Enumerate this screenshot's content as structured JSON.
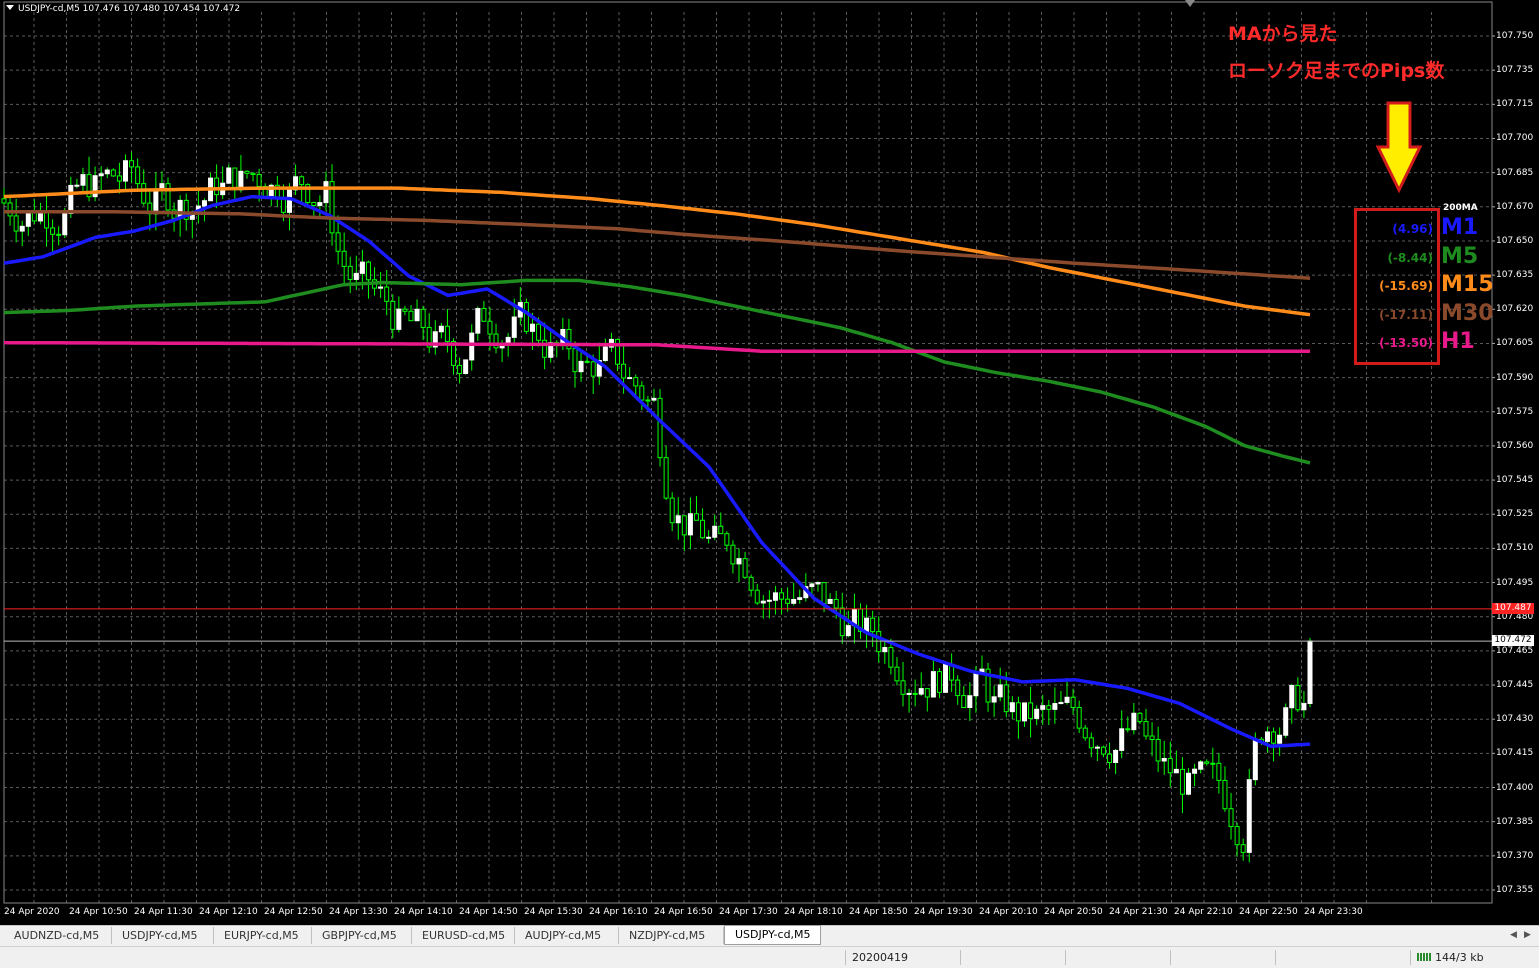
{
  "chart_header": {
    "text": "USDJPY-cd,M5  107.476 107.480 107.454 107.472"
  },
  "y_axis": {
    "labels": [
      "107.750",
      "107.735",
      "107.715",
      "107.700",
      "107.685",
      "107.670",
      "107.650",
      "107.635",
      "107.620",
      "107.605",
      "107.590",
      "107.575",
      "107.560",
      "107.545",
      "107.525",
      "107.510",
      "107.495",
      "107.480",
      "107.465",
      "107.445",
      "107.430",
      "107.415",
      "107.400",
      "107.385",
      "107.370",
      "107.355"
    ],
    "price_tags": [
      {
        "text": "107.487",
        "color": "#ff2222",
        "text_color": "#ffffff"
      },
      {
        "text": "107.472",
        "color": "#ffffff",
        "text_color": "#000000"
      }
    ]
  },
  "x_axis": {
    "labels": [
      "24 Apr 2020",
      "24 Apr 10:50",
      "24 Apr 11:30",
      "24 Apr 12:10",
      "24 Apr 12:50",
      "24 Apr 13:30",
      "24 Apr 14:10",
      "24 Apr 14:50",
      "24 Apr 15:30",
      "24 Apr 16:10",
      "24 Apr 16:50",
      "24 Apr 17:30",
      "24 Apr 18:10",
      "24 Apr 18:50",
      "24 Apr 19:30",
      "24 Apr 20:10",
      "24 Apr 20:50",
      "24 Apr 21:30",
      "24 Apr 22:10",
      "24 Apr 22:50",
      "24 Apr 23:30"
    ]
  },
  "annotation": {
    "line1": "MAから見た",
    "line2": "ローソク足までのPips数",
    "arrow_color": "#ffee00",
    "box_color": "#d21c1c"
  },
  "ma_panel": {
    "title": "200MA",
    "rows": [
      {
        "value": "(4.96)",
        "tf": "M1",
        "color": "#1a1aff"
      },
      {
        "value": "(-8.44)",
        "tf": "M5",
        "color": "#1e8c1e"
      },
      {
        "value": "(-15.69)",
        "tf": "M15",
        "color": "#ff8c1a"
      },
      {
        "value": "(-17.11)",
        "tf": "M30",
        "color": "#8b4a2b"
      },
      {
        "value": "(-13.50)",
        "tf": "H1",
        "color": "#e8198b"
      }
    ]
  },
  "colors": {
    "background": "#000000",
    "grid": "#5a5a5a",
    "bull": "#ffffff",
    "bear": "#00ff00",
    "candle_outline": "#00ff00"
  },
  "tabs": [
    "AUDNZD-cd,M5",
    "USDJPY-cd,M5",
    "EURJPY-cd,M5",
    "GBPJPY-cd,M5",
    "EURUSD-cd,M5",
    "AUDJPY-cd,M5",
    "NZDJPY-cd,M5",
    "USDJPY-cd,M5"
  ],
  "active_tab_index": 7,
  "status_bar": {
    "profile": "20200419",
    "traffic": "144/3 kb"
  },
  "chart_data": {
    "type": "candlestick",
    "symbol": "USDJPY-cd",
    "timeframe": "M5",
    "ylim": [
      107.35,
      107.765
    ],
    "last": {
      "open": 107.476,
      "high": 107.48,
      "low": 107.454,
      "close": 107.472
    },
    "bid_line": 107.487,
    "moving_averages": [
      {
        "name": "M1",
        "color": "#1a1aff",
        "pips": "(4.96)",
        "points": [
          [
            0,
            107.648
          ],
          [
            0.03,
            107.651
          ],
          [
            0.07,
            107.66
          ],
          [
            0.1,
            107.663
          ],
          [
            0.13,
            107.668
          ],
          [
            0.16,
            107.675
          ],
          [
            0.19,
            107.679
          ],
          [
            0.22,
            107.678
          ],
          [
            0.25,
            107.67
          ],
          [
            0.28,
            107.658
          ],
          [
            0.31,
            107.642
          ],
          [
            0.34,
            107.633
          ],
          [
            0.37,
            107.636
          ],
          [
            0.4,
            107.625
          ],
          [
            0.43,
            107.612
          ],
          [
            0.46,
            107.6
          ],
          [
            0.5,
            107.576
          ],
          [
            0.54,
            107.553
          ],
          [
            0.58,
            107.518
          ],
          [
            0.62,
            107.492
          ],
          [
            0.66,
            107.476
          ],
          [
            0.7,
            107.466
          ],
          [
            0.74,
            107.458
          ],
          [
            0.78,
            107.453
          ],
          [
            0.82,
            107.454
          ],
          [
            0.86,
            107.45
          ],
          [
            0.9,
            107.443
          ],
          [
            0.94,
            107.431
          ],
          [
            0.97,
            107.423
          ],
          [
            1,
            107.424
          ]
        ]
      },
      {
        "name": "M5",
        "color": "#1e8c1e",
        "points": [
          [
            0,
            107.625
          ],
          [
            0.05,
            107.626
          ],
          [
            0.1,
            107.628
          ],
          [
            0.15,
            107.629
          ],
          [
            0.2,
            107.63
          ],
          [
            0.23,
            107.634
          ],
          [
            0.26,
            107.638
          ],
          [
            0.29,
            107.639
          ],
          [
            0.35,
            107.638
          ],
          [
            0.4,
            107.64
          ],
          [
            0.44,
            107.64
          ],
          [
            0.48,
            107.637
          ],
          [
            0.52,
            107.633
          ],
          [
            0.56,
            107.628
          ],
          [
            0.6,
            107.623
          ],
          [
            0.64,
            107.618
          ],
          [
            0.68,
            107.611
          ],
          [
            0.72,
            107.602
          ],
          [
            0.76,
            107.597
          ],
          [
            0.8,
            107.593
          ],
          [
            0.84,
            107.588
          ],
          [
            0.88,
            107.581
          ],
          [
            0.92,
            107.572
          ],
          [
            0.95,
            107.563
          ],
          [
            0.98,
            107.558
          ],
          [
            1,
            107.555
          ]
        ]
      },
      {
        "name": "M15",
        "color": "#ff8c1a",
        "points": [
          [
            0,
            107.679
          ],
          [
            0.1,
            107.682
          ],
          [
            0.2,
            107.683
          ],
          [
            0.3,
            107.683
          ],
          [
            0.38,
            107.681
          ],
          [
            0.45,
            107.678
          ],
          [
            0.5,
            107.675
          ],
          [
            0.56,
            107.671
          ],
          [
            0.62,
            107.666
          ],
          [
            0.66,
            107.662
          ],
          [
            0.7,
            107.658
          ],
          [
            0.75,
            107.653
          ],
          [
            0.8,
            107.646
          ],
          [
            0.85,
            107.64
          ],
          [
            0.9,
            107.634
          ],
          [
            0.95,
            107.628
          ],
          [
            1,
            107.624
          ]
        ]
      },
      {
        "name": "M30",
        "color": "#8b4a2b",
        "points": [
          [
            0,
            107.672
          ],
          [
            0.08,
            107.672
          ],
          [
            0.18,
            107.671
          ],
          [
            0.25,
            107.669
          ],
          [
            0.32,
            107.668
          ],
          [
            0.4,
            107.666
          ],
          [
            0.47,
            107.664
          ],
          [
            0.53,
            107.661
          ],
          [
            0.6,
            107.658
          ],
          [
            0.68,
            107.654
          ],
          [
            0.75,
            107.651
          ],
          [
            0.82,
            107.648
          ],
          [
            0.9,
            107.645
          ],
          [
            1,
            107.641
          ]
        ]
      },
      {
        "name": "H1",
        "color": "#e8198b",
        "points": [
          [
            0,
            107.611
          ],
          [
            0.5,
            107.61
          ],
          [
            0.58,
            107.607
          ],
          [
            1,
            107.607
          ]
        ]
      }
    ]
  }
}
